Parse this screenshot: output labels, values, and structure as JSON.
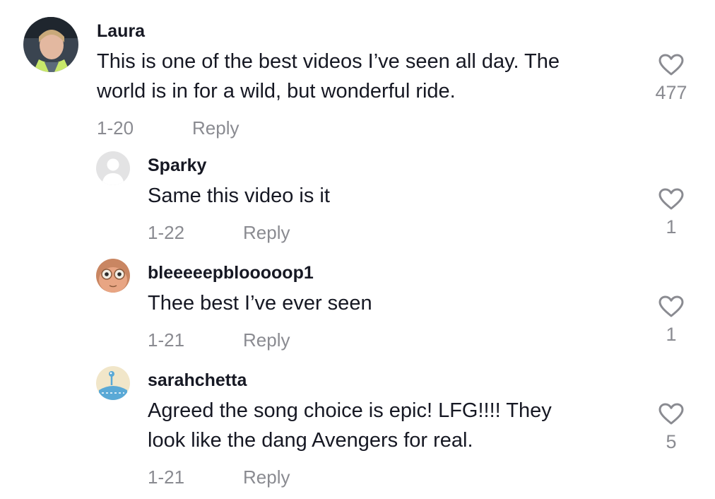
{
  "comments": [
    {
      "username": "Laura",
      "text_lines": [
        "This is one of the best videos I’ve seen all day. The",
        "world is in for a wild, but wonderful ride."
      ],
      "date": "1-20",
      "reply_label": "Reply",
      "likes": "477",
      "avatar": "profile-photo-woman"
    },
    {
      "username": "Sparky",
      "text_lines": [
        "Same this video is it"
      ],
      "date": "1-22",
      "reply_label": "Reply",
      "likes": "1",
      "avatar": "default-avatar"
    },
    {
      "username": "bleeeeepblooooop1",
      "text_lines": [
        "Thee best I’ve ever seen"
      ],
      "date": "1-21",
      "reply_label": "Reply",
      "likes": "1",
      "avatar": "cartoon-face"
    },
    {
      "username": "sarahchetta",
      "text_lines": [
        "Agreed the song choice is epic! LFG!!!! They",
        "look like the dang Avengers for real."
      ],
      "date": "1-21",
      "reply_label": "Reply",
      "likes": "5",
      "avatar": "blue-creature"
    }
  ]
}
